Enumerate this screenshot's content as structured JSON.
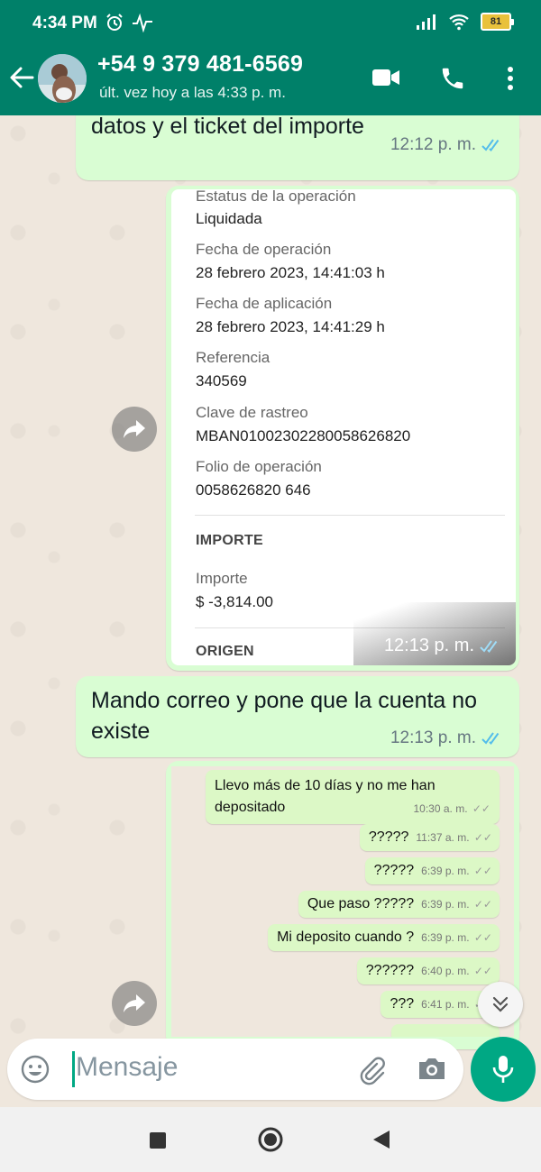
{
  "status_bar": {
    "time": "4:34 PM",
    "battery": "81"
  },
  "header": {
    "contact_name": "+54 9 379 481-6569",
    "last_seen": "últ. vez hoy a las 4:33 p. m.",
    "icons": [
      "back-arrow-icon",
      "video-call-icon",
      "phone-icon",
      "more-options-icon"
    ]
  },
  "messages": [
    {
      "text": "datos y el ticket del importe",
      "time": "12:12 p. m."
    },
    {
      "text": "Mando correo y pone que la cuenta no existe",
      "time": "12:13 p. m."
    }
  ],
  "receipt_image": {
    "time": "12:13 p. m.",
    "fields": [
      {
        "label": "Estatus de la operación",
        "value": "Liquidada"
      },
      {
        "label": "Fecha de operación",
        "value": "28 febrero 2023, 14:41:03 h"
      },
      {
        "label": "Fecha de aplicación",
        "value": "28 febrero 2023, 14:41:29 h"
      },
      {
        "label": "Referencia",
        "value": "340569"
      },
      {
        "label": "Clave de rastreo",
        "value": "MBAN01002302280058626820"
      },
      {
        "label": "Folio de operación",
        "value": "0058626820 646"
      }
    ],
    "section_importe": "IMPORTE",
    "importe_label": "Importe",
    "importe_value": "$ -3,814.00",
    "section_origen": "ORIGEN"
  },
  "screenshot_messages": [
    {
      "text": "Llevo más de 10 días y no me han",
      "text2": "depositado",
      "time": "10:30 a. m."
    },
    {
      "text": "?????",
      "time": "11:37 a. m."
    },
    {
      "text": "?????",
      "time": "6:39 p. m."
    },
    {
      "text": "Que paso ?????",
      "time": "6:39 p. m."
    },
    {
      "text": "Mi deposito cuando ?",
      "time": "6:39 p. m."
    },
    {
      "text": "??????",
      "time": "6:40 p. m."
    },
    {
      "text": "???",
      "time": "6:41 p. m."
    }
  ],
  "composer": {
    "placeholder": "Mensaje"
  },
  "colors": {
    "header": "#008069",
    "outgoing_bubble": "#d9fdd3",
    "accent": "#00a884",
    "read_ticks": "#53bdeb"
  }
}
